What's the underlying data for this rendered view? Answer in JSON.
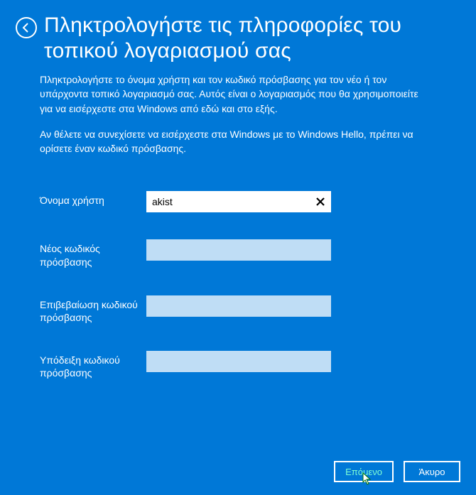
{
  "header": {
    "title": "Πληκτρολογήστε τις πληροφορίες του τοπικού λογαριασμού σας"
  },
  "body": {
    "p1": "Πληκτρολογήστε το όνομα χρήστη και τον κωδικό πρόσβασης για τον νέο ή τον υπάρχοντα τοπικό λογαριασμό σας. Αυτός είναι ο λογαριασμός που θα χρησιμοποιείτε για να εισέρχεστε στα Windows από εδώ και στο εξής.",
    "p2": "Αν θέλετε να συνεχίσετε να εισέρχεστε στα Windows με το Windows Hello, πρέπει να ορίσετε έναν κωδικό πρόσβασης."
  },
  "form": {
    "username_label": "Όνομα χρήστη",
    "username_value": "akist",
    "newpass_label": "Νέος κωδικός πρόσβασης",
    "newpass_value": "",
    "confirm_label": "Επιβεβαίωση κωδικού πρόσβασης",
    "confirm_value": "",
    "hint_label": "Υπόδειξη κωδικού πρόσβασης",
    "hint_value": ""
  },
  "footer": {
    "next_label": "Επόμενο",
    "cancel_label": "Άκυρο"
  }
}
